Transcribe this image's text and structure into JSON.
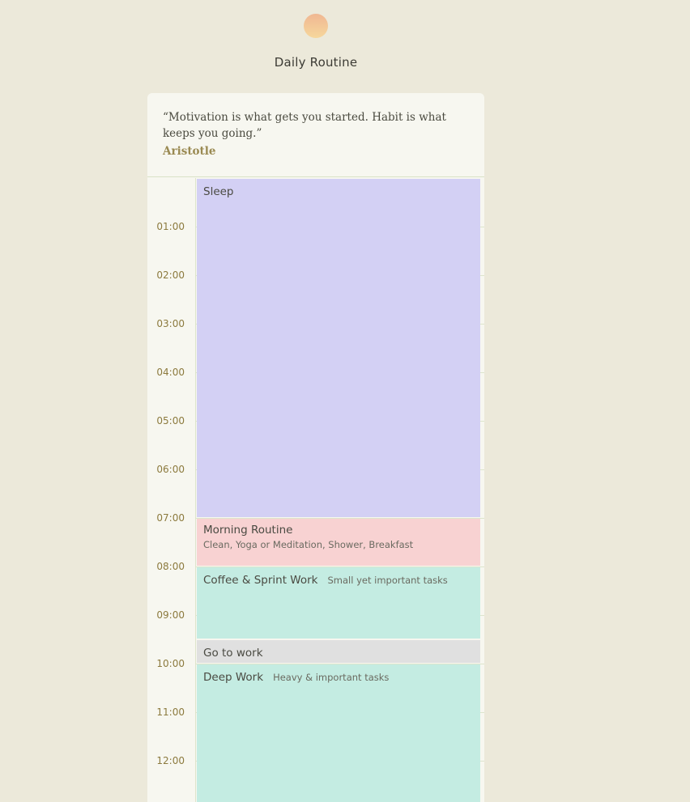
{
  "app": {
    "title": "Daily Routine"
  },
  "quote": {
    "text": "“Motivation is what gets you started. Habit is what keeps you going.”",
    "author": "Aristotle"
  },
  "timeline": {
    "hours": [
      "01:00",
      "02:00",
      "03:00",
      "04:00",
      "05:00",
      "06:00",
      "07:00",
      "08:00",
      "09:00",
      "10:00",
      "11:00",
      "12:00"
    ]
  },
  "events": [
    {
      "title": "Sleep",
      "description": "",
      "start": "00:00",
      "end": "07:00",
      "color": "#d3d0f4"
    },
    {
      "title": "Morning Routine",
      "description": "Clean, Yoga or Meditation, Shower, Breakfast",
      "start": "07:00",
      "end": "08:00",
      "color": "#f8d2d2"
    },
    {
      "title": "Coffee & Sprint Work",
      "description": "Small yet important tasks",
      "start": "08:00",
      "end": "09:30",
      "color": "#c4ece2"
    },
    {
      "title": "Go to work",
      "description": "",
      "start": "09:30",
      "end": "10:00",
      "color": "#e0e0e0"
    },
    {
      "title": "Deep Work",
      "description": "Heavy & important tasks",
      "start": "10:00",
      "end": "13:00",
      "color": "#c4ece2"
    }
  ]
}
